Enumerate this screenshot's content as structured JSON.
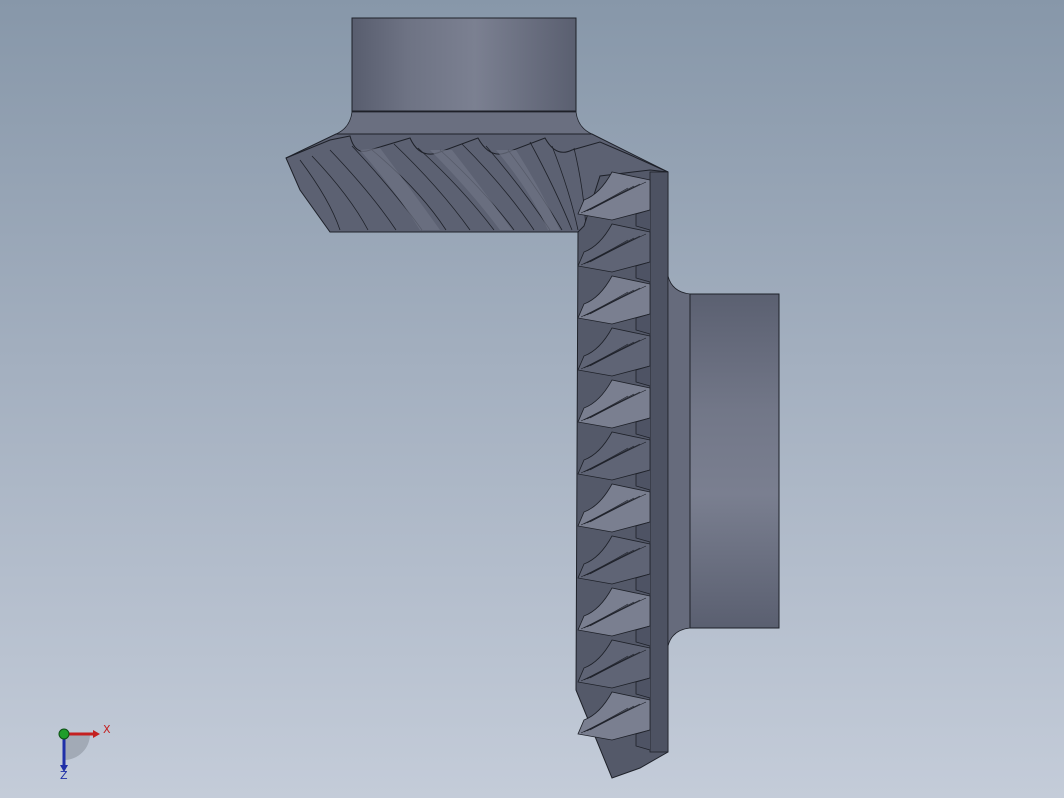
{
  "viewport": {
    "background_top": "#8797a9",
    "background_bottom": "#c4ccd9",
    "model": {
      "description_icon": "bevel-gear-pair-icon",
      "colors": {
        "face_dark": "#4e5364",
        "face_mid": "#5f6475",
        "face_light": "#7a7f90",
        "edge": "#1e2129"
      }
    }
  },
  "triad": {
    "x_label": "X",
    "z_label": "Z",
    "x_color": "#c42020",
    "y_color": "#1f9e2a",
    "z_color": "#1f2fa8"
  }
}
